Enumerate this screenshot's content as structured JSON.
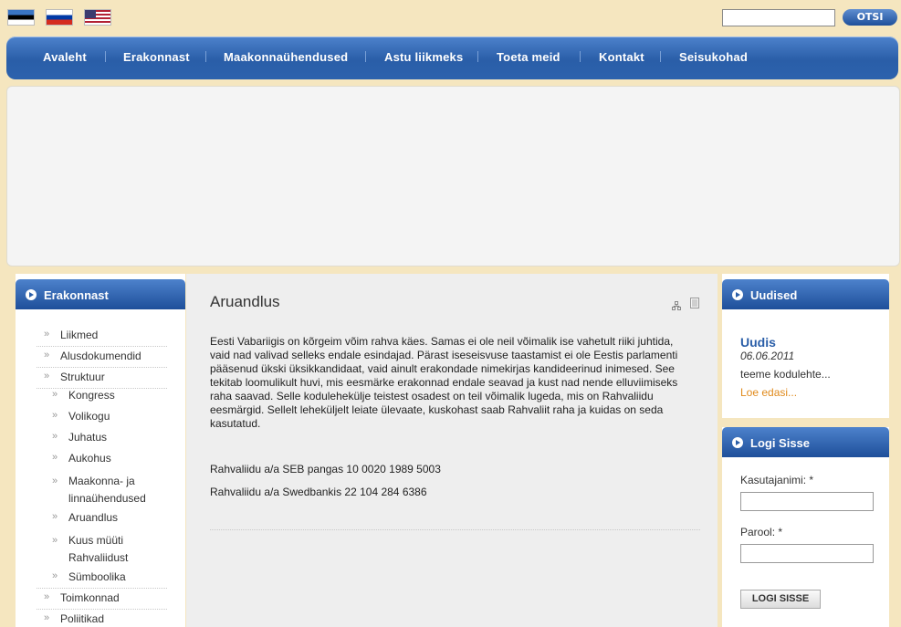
{
  "header": {
    "flags": [
      "flag-estonia-icon",
      "flag-russia-icon",
      "flag-usa-icon"
    ],
    "search": {
      "value": "",
      "button_label": "OTSI"
    }
  },
  "nav": {
    "items": [
      "Avaleht",
      "Erakonnast",
      "Maakonnaühendused",
      "Astu liikmeks",
      "Toeta meid",
      "Kontakt",
      "Seisukohad"
    ]
  },
  "sidebar": {
    "title": "Erakonnast",
    "items": [
      {
        "label": "Liikmed"
      },
      {
        "label": "Alusdokumendid"
      },
      {
        "label": "Struktuur"
      },
      {
        "label": "Kongress"
      },
      {
        "label": "Volikogu"
      },
      {
        "label": "Juhatus"
      },
      {
        "label": "Aukohus"
      },
      {
        "label": "Maakonna- ja"
      },
      {
        "label": "linnaühendused"
      },
      {
        "label": "Aruandlus"
      },
      {
        "label": "Kuus müüti"
      },
      {
        "label": "Rahvaliidust"
      },
      {
        "label": "Sümboolika"
      },
      {
        "label": "Toimkonnad"
      },
      {
        "label": "Poliitikad"
      }
    ]
  },
  "main": {
    "title": "Aruandlus",
    "lines": [
      "Eesti Vabariigis on kõrgeim võim rahva käes. Samas ei ole neil võimalik ise vahetult riiki juhtida,",
      "vaid nad valivad selleks endale esindajad. Pärast iseseisvuse taastamist ei ole Eestis parlamenti",
      "pääsenud ükski üksikkandidaat, vaid ainult erakondade nimekirjas kandideerinud inimesed. See",
      "tekitab loomulikult huvi, mis eesmärke erakonnad endale seavad ja kust nad nende elluviimiseks",
      "raha saavad. Selle kodulehekülje teistest osadest on teil võimalik lugeda, mis on Rahvaliidu",
      "eesmärgid. Sellelt leheküljelt leiate ülevaate, kuskohast saab Rahvaliit raha ja kuidas on seda",
      "kasutatud."
    ],
    "bank1": "Rahvaliidu a/a SEB pangas 10 0020 1989 5003",
    "bank2": "Rahvaliidu a/a Swedbankis 22 104 284 6386"
  },
  "news": {
    "title": "Uudised",
    "item_title": "Uudis",
    "date": "06.06.2011",
    "text": "teeme kodulehte...",
    "more": "Loe edasi..."
  },
  "login": {
    "title": "Logi Sisse",
    "username_label": "Kasutajanimi: *",
    "password_label": "Parool: *",
    "button_label": "LOGI SISSE"
  }
}
